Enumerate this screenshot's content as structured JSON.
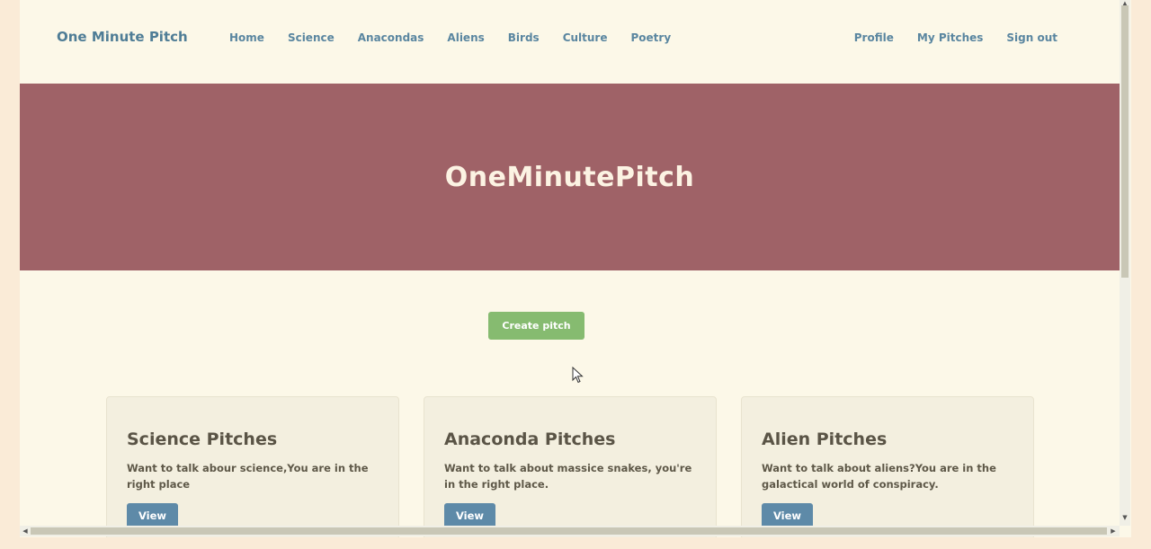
{
  "nav": {
    "brand": "One Minute Pitch",
    "left_links": [
      "Home",
      "Science",
      "Anacondas",
      "Aliens",
      "Birds",
      "Culture",
      "Poetry"
    ],
    "right_links": [
      "Profile",
      "My Pitches",
      "Sign out"
    ]
  },
  "hero": {
    "title": "OneMinutePitch"
  },
  "actions": {
    "create_label": "Create pitch"
  },
  "cards": [
    {
      "title": "Science Pitches",
      "text": "Want to talk abour science,You are in the right place",
      "button": "View"
    },
    {
      "title": "Anaconda Pitches",
      "text": "Want to talk about massice snakes, you're in the right place.",
      "button": "View"
    },
    {
      "title": "Alien Pitches",
      "text": "Want to talk about aliens?You are in the galactical world of conspiracy.",
      "button": "View"
    }
  ],
  "icons": {
    "cursor": "mouse-pointer-icon",
    "scroll_up": "arrow-up-icon",
    "scroll_down": "arrow-down-icon",
    "scroll_left": "arrow-left-icon",
    "scroll_right": "arrow-right-icon"
  },
  "colors": {
    "page_bg": "#fcf8e8",
    "outer_bg": "#faebd7",
    "hero_bg": "#9f6267",
    "nav_link": "#5a86a0",
    "create_button": "#86bb70",
    "view_button": "#5e8aa8",
    "card_bg": "#f3efdf"
  }
}
